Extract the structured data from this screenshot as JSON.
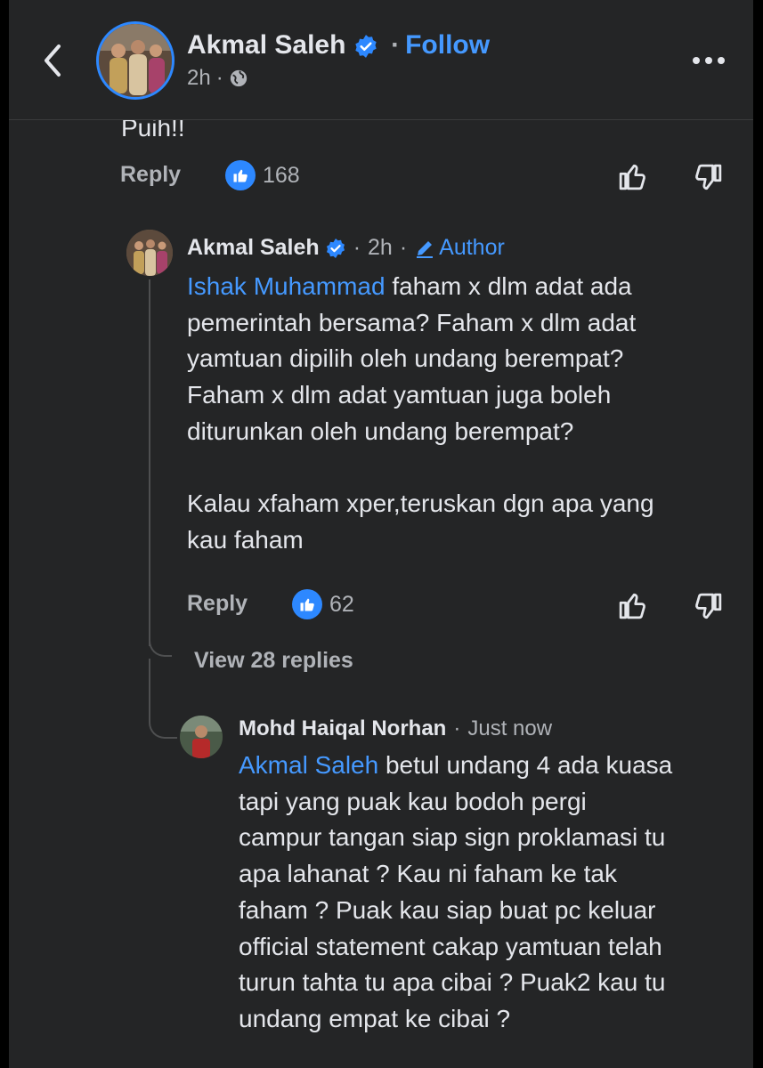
{
  "header": {
    "name": "Akmal Saleh",
    "follow_label": "Follow",
    "time": "2h",
    "separator": "·"
  },
  "truncated_text": "Puih!!",
  "comment1_actions": {
    "reply_label": "Reply",
    "like_count": "168"
  },
  "reply1": {
    "name": "Akmal Saleh",
    "time": "2h",
    "separator": "·",
    "author_label": "Author",
    "mention": "Ishak Muhammad",
    "text_lines": [
      " faham x dlm adat ada",
      "pemerintah bersama? Faham x dlm adat",
      "yamtuan dipilih oleh undang berempat?",
      "Faham x dlm adat yamtuan juga boleh",
      "diturunkan oleh undang berempat?"
    ],
    "text_para2": [
      "Kalau xfaham xper,teruskan dgn apa yang",
      "kau faham"
    ],
    "reply_label": "Reply",
    "like_count": "62"
  },
  "view_replies": "View 28 replies",
  "reply2": {
    "name": "Mohd Haiqal Norhan",
    "separator": "·",
    "time": "Just now",
    "mention": "Akmal Saleh",
    "text_lines": [
      " betul undang 4 ada kuasa",
      "tapi yang puak kau bodoh pergi",
      "campur tangan siap sign proklamasi tu",
      "apa lahanat ? Kau ni faham ke tak",
      "faham ? Puak kau siap buat pc keluar",
      "official statement cakap yamtuan telah",
      "turun tahta tu apa cibai ? Puak2 kau tu",
      "undang empat ke cibai ?"
    ]
  },
  "colors": {
    "background": "#242526",
    "accent": "#2d88ff",
    "link": "#4599ff",
    "muted": "#b0b3b8",
    "text": "#e4e6eb"
  },
  "icons": [
    "back-chevron-icon",
    "verified-badge-icon",
    "globe-icon",
    "more-icon",
    "like-icon",
    "upvote-icon",
    "downvote-icon",
    "pencil-icon"
  ]
}
